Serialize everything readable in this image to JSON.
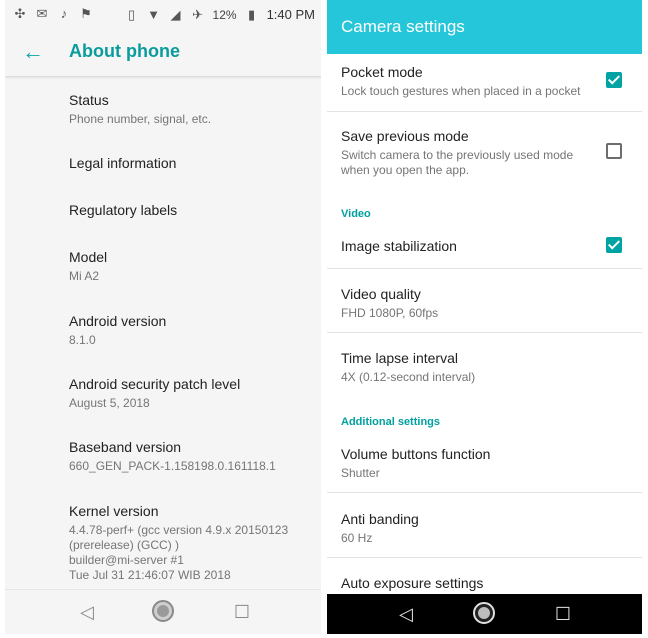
{
  "left": {
    "statusbar": {
      "battery": "12%",
      "time": "1:40 PM"
    },
    "appbar": {
      "title": "About phone"
    },
    "items": [
      {
        "title": "Status",
        "subtitle": "Phone number, signal, etc."
      },
      {
        "title": "Legal information",
        "subtitle": ""
      },
      {
        "title": "Regulatory labels",
        "subtitle": ""
      },
      {
        "title": "Model",
        "subtitle": "Mi A2"
      },
      {
        "title": "Android version",
        "subtitle": "8.1.0"
      },
      {
        "title": "Android security patch level",
        "subtitle": "August 5, 2018"
      },
      {
        "title": "Baseband version",
        "subtitle": "660_GEN_PACK-1.158198.0.161118.1"
      },
      {
        "title": "Kernel version",
        "subtitle": "4.4.78-perf+ (gcc version 4.9.x 20150123\n(prerelease) (GCC) )\nbuilder@mi-server #1\nTue Jul 31 21:46:07 WIB 2018"
      }
    ]
  },
  "right": {
    "appbar": {
      "title": "Camera settings"
    },
    "items": [
      {
        "title": "Pocket mode",
        "subtitle": "Lock touch gestures when placed in a pocket",
        "checked": true
      },
      {
        "title": "Save previous mode",
        "subtitle": "Switch camera to the previously used mode when you open the app.",
        "checked": false
      }
    ],
    "section_video": "Video",
    "video_items": [
      {
        "title": "Image stabilization",
        "subtitle": "",
        "checked": true
      },
      {
        "title": "Video quality",
        "subtitle": "FHD 1080P, 60fps"
      },
      {
        "title": "Time lapse interval",
        "subtitle": "4X (0.12-second interval)"
      }
    ],
    "section_additional": "Additional settings",
    "additional_items": [
      {
        "title": "Volume buttons function",
        "subtitle": "Shutter"
      },
      {
        "title": "Anti banding",
        "subtitle": "60 Hz"
      },
      {
        "title": "Auto exposure settings",
        "subtitle": ""
      }
    ]
  },
  "icons": {
    "back": "arrow-left-icon",
    "home": "home-circle-icon",
    "recent": "recent-square-icon",
    "back_nav": "back-triangle-icon"
  }
}
